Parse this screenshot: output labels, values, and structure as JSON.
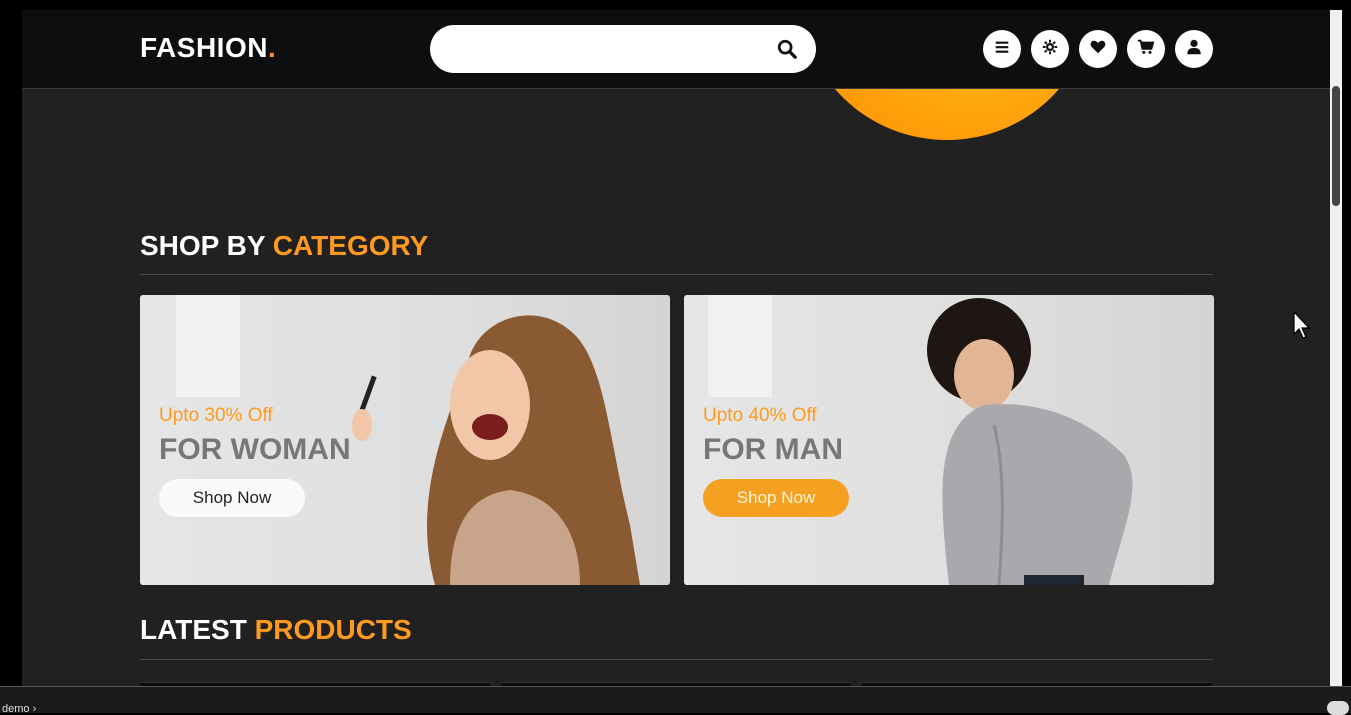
{
  "brand": {
    "name": "FASHION",
    "dot": "."
  },
  "search": {
    "placeholder": ""
  },
  "header_icons": [
    "menu-icon",
    "gear-icon",
    "heart-icon",
    "cart-icon",
    "user-icon"
  ],
  "category": {
    "title_main": "SHOP BY ",
    "title_accent": "CATEGORY",
    "cards": [
      {
        "offer": "Upto 30% Off",
        "heading": "FOR WOMAN",
        "button": "Shop Now"
      },
      {
        "offer": "Upto 40% Off",
        "heading": "FOR MAN",
        "button": "Shop Now"
      }
    ]
  },
  "latest": {
    "title_main": "LATEST ",
    "title_accent": "PRODUCTS"
  },
  "bottom": {
    "crumb": "demo"
  },
  "colors": {
    "accent": "#ff9a1f",
    "background": "#212121",
    "header": "#0e0e0e"
  }
}
